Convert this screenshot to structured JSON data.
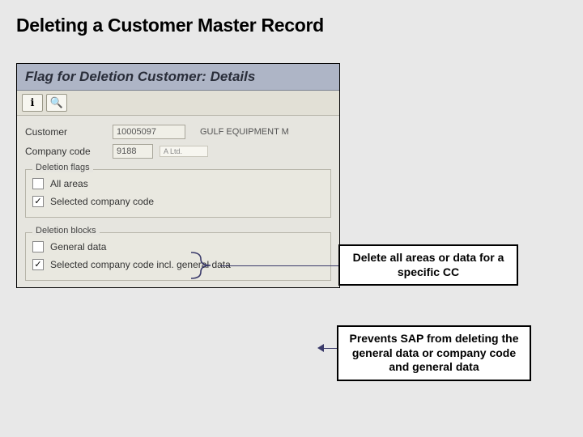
{
  "slide": {
    "title": "Deleting a Customer Master Record"
  },
  "sap": {
    "title": "Flag for Deletion Customer: Details",
    "toolbar": {
      "info_icon": "ℹ",
      "search_icon": "🔍"
    },
    "fields": {
      "customer_label": "Customer",
      "customer_value": "10005097",
      "customer_desc": "GULF EQUIPMENT M",
      "company_label": "Company code",
      "company_value": "9188",
      "company_lookup": "A Ltd."
    },
    "group_flags": {
      "label": "Deletion flags",
      "all_areas": "All areas",
      "all_areas_checked": "",
      "selected_cc": "Selected company code",
      "selected_cc_checked": "✓"
    },
    "group_blocks": {
      "label": "Deletion blocks",
      "general": "General data",
      "general_checked": "",
      "selected_incl": "Selected company code incl. general data",
      "selected_incl_checked": "✓"
    }
  },
  "callouts": {
    "c1": "Delete all areas\nor data for a specific CC",
    "c2": "Prevents SAP from deleting the general data or company code and general data"
  }
}
